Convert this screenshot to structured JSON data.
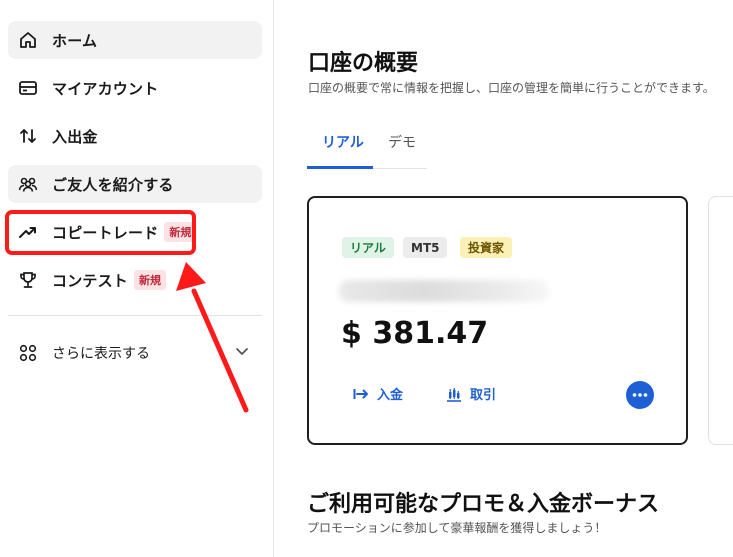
{
  "sidebar": {
    "items": [
      {
        "label": "ホーム",
        "icon": "home-icon"
      },
      {
        "label": "マイアカウント",
        "icon": "wallet-icon"
      },
      {
        "label": "入出金",
        "icon": "transfer-icon"
      },
      {
        "label": "ご友人を紹介する",
        "icon": "people-icon"
      },
      {
        "label": "コピートレード",
        "icon": "trend-up-icon",
        "badge": "新規"
      },
      {
        "label": "コンテスト",
        "icon": "trophy-icon",
        "badge": "新規"
      }
    ],
    "more": {
      "label": "さらに表示する",
      "icon": "grid-icon"
    }
  },
  "main": {
    "title": "口座の概要",
    "subtitle": "口座の概要で常に情報を把握し、口座の管理を簡単に行うことができます。",
    "tabs": [
      "リアル",
      "デモ"
    ],
    "account_card": {
      "tags": [
        "リアル",
        "MT5",
        "投資家"
      ],
      "balance": "$ 381.47",
      "actions": {
        "deposit": "入金",
        "trade": "取引"
      }
    },
    "promo": {
      "title": "ご利用可能なプロモ＆入金ボーナス",
      "subtitle": "プロモーションに参加して豪華報酬を獲得しましょう！"
    }
  },
  "colors": {
    "accent": "#1f5fd6",
    "highlight": "#ff1a1a",
    "badge_bg": "#fde2e4",
    "badge_text": "#c0283b"
  }
}
